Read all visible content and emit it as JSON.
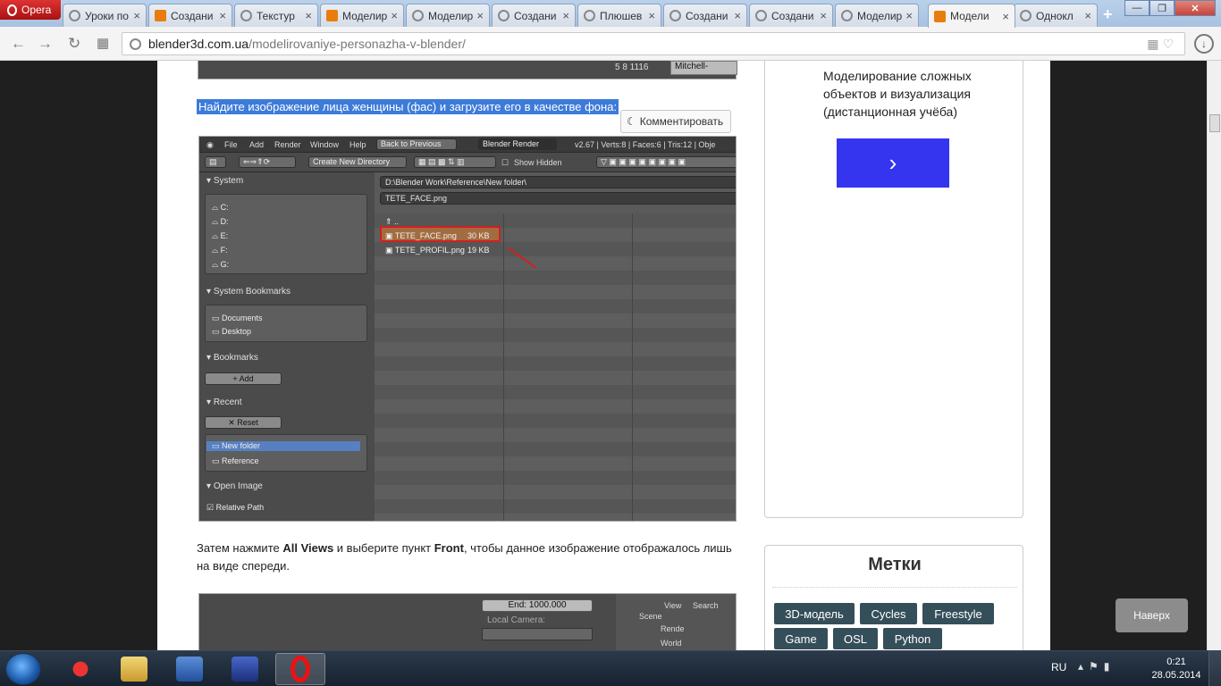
{
  "browser": {
    "app_name": "Opera",
    "tabs": [
      {
        "label": "Уроки по",
        "icon": "globe-icon"
      },
      {
        "label": "Создани",
        "icon": "blender-icon"
      },
      {
        "label": "Текстур",
        "icon": "globe-icon"
      },
      {
        "label": "Моделир",
        "icon": "blender-icon"
      },
      {
        "label": "Моделир",
        "icon": "globe-icon"
      },
      {
        "label": "Создани",
        "icon": "globe-icon"
      },
      {
        "label": "Плюшев",
        "icon": "globe-icon"
      },
      {
        "label": "Создани",
        "icon": "globe-icon"
      },
      {
        "label": "Создани",
        "icon": "globe-icon"
      },
      {
        "label": "Моделир",
        "icon": "globe-icon"
      },
      {
        "label": "Модели",
        "icon": "blender-icon"
      },
      {
        "label": "Однокл",
        "icon": "globe-icon"
      }
    ],
    "active_tab": 10,
    "url_domain": "blender3d.com.ua",
    "url_path": "/modelirovaniye-personazha-v-blender/"
  },
  "article": {
    "top_image": {
      "toolbar_text": "5  8  1116",
      "mitchell_label": "Mitchell-"
    },
    "caption": "Найдите изображение лица женщины (фас) и загрузите его в качестве фона:",
    "comment_button": "Комментировать",
    "blender_shot": {
      "menu": [
        "File",
        "Add",
        "Render",
        "Window",
        "Help"
      ],
      "back_button": "Back to Previous",
      "render_select": "Blender Render",
      "stats": "v2.67 | Verts:8 | Faces:6 | Tris:12 | Obje",
      "create_dir": "Create New Directory",
      "show_hidden": "Show Hidden",
      "path": "D:\\Blender Work\\Reference\\New folder\\",
      "filename": "TETE_FACE.png",
      "up_label": "..",
      "files": [
        {
          "name": "TETE_FACE.png",
          "size": "30 KB"
        },
        {
          "name": "TETE_PROFIL.png",
          "size": "19 KB"
        }
      ],
      "system_title": "System",
      "drives": [
        "C:",
        "D:",
        "E:",
        "F:",
        "G:"
      ],
      "bookmarks_sys_title": "System Bookmarks",
      "bookmarks_sys": [
        "Documents",
        "Desktop"
      ],
      "bookmarks_title": "Bookmarks",
      "add_label": "Add",
      "recent_title": "Recent",
      "reset_label": "Reset",
      "recent": [
        "New folder",
        "Reference"
      ],
      "open_image_title": "Open Image",
      "relative_path": "Relative Path"
    },
    "paragraph_pre": "Затем нажмите ",
    "paragraph_b1": "All Views",
    "paragraph_mid": " и выберите пункт ",
    "paragraph_b2": "Front",
    "paragraph_post": ", чтобы данное изображение отображалось лишь на виде спереди.",
    "second_shot": {
      "end_field": "End: 1000.000",
      "local_camera": "Local Camera:",
      "panel_items": [
        "View",
        "Search",
        "Scene",
        "Rende",
        "World"
      ]
    }
  },
  "sidebar": {
    "promo_text": "Моделирование сложных объектов и визуализация (дистанционная учёба)",
    "promo_button": "›",
    "tags_title": "Метки",
    "tags": [
      "3D-модель",
      "Cycles",
      "Freestyle",
      "Game",
      "OSL",
      "Python"
    ]
  },
  "back_to_top": "Наверх",
  "taskbar": {
    "lang": "RU",
    "time": "0:21",
    "date": "28.05.2014"
  }
}
